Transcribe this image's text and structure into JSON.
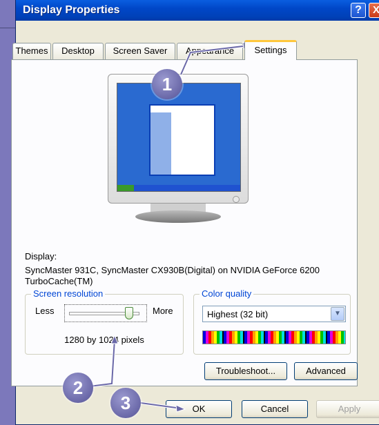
{
  "window": {
    "title": "Display Properties",
    "help_glyph": "?",
    "close_glyph": "X"
  },
  "tabs": [
    "Themes",
    "Desktop",
    "Screen Saver",
    "Appearance",
    "Settings"
  ],
  "display": {
    "label": "Display:",
    "value": "SyncMaster 931C, SyncMaster CX930B(Digital) on NVIDIA GeForce 6200 TurboCache(TM)"
  },
  "screen_resolution": {
    "label": "Screen resolution",
    "less": "Less",
    "more": "More",
    "value": "1280 by 1024 pixels",
    "slider_level": 0.95
  },
  "color_quality": {
    "label": "Color quality",
    "selected": "Highest (32 bit)"
  },
  "buttons": {
    "troubleshoot": "Troubleshoot...",
    "advanced": "Advanced",
    "ok": "OK",
    "cancel": "Cancel",
    "apply": "Apply"
  },
  "callouts": [
    "1",
    "2",
    "3"
  ],
  "colors": {
    "title_bar": "#0047c8",
    "tab_accent": "#ffc73c",
    "callout": "#6a68a8"
  }
}
